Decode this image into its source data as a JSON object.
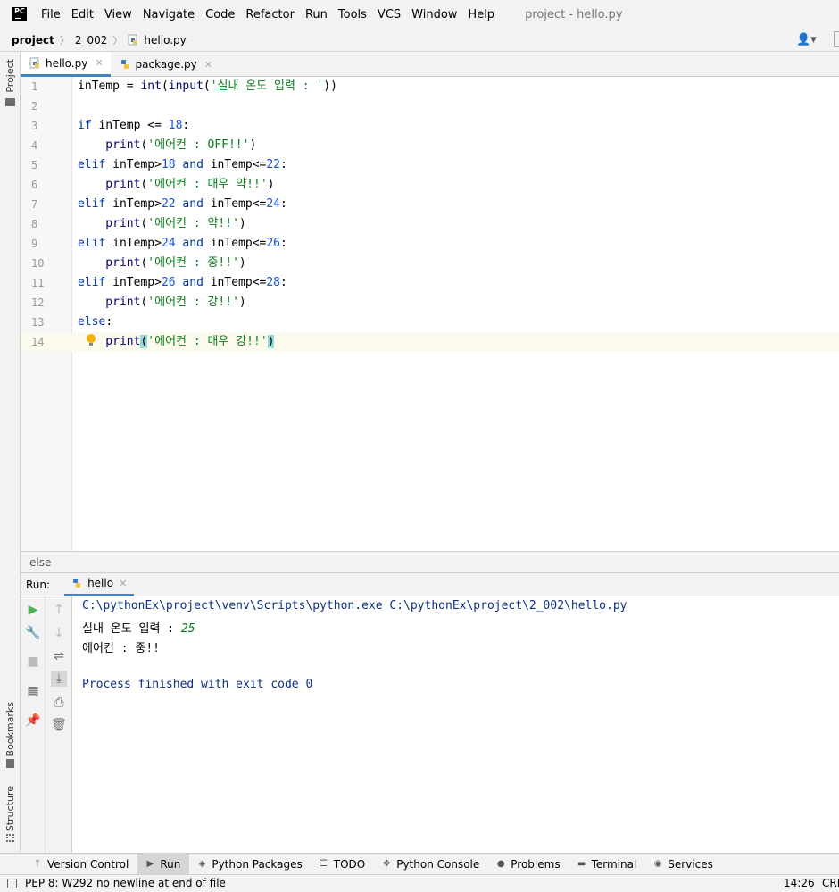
{
  "menu": {
    "logo_text": "PC",
    "items": [
      "File",
      "Edit",
      "View",
      "Navigate",
      "Code",
      "Refactor",
      "Run",
      "Tools",
      "VCS",
      "Window",
      "Help"
    ],
    "window_title": "project - hello.py"
  },
  "nav": {
    "crumbs": [
      "project",
      "2_002",
      "hello.py"
    ]
  },
  "left_strip": {
    "project": "Project",
    "bookmarks": "Bookmarks",
    "structure": "Structure"
  },
  "tabs": [
    {
      "label": "hello.py"
    },
    {
      "label": "package.py"
    }
  ],
  "editor": {
    "line_numbers": [
      "1",
      "2",
      "3",
      "4",
      "5",
      "6",
      "7",
      "8",
      "9",
      "10",
      "11",
      "12",
      "13",
      "14"
    ],
    "lines": [
      [
        {
          "t": "inTemp = ",
          "c": "pr"
        },
        {
          "t": "int",
          "c": "bi"
        },
        {
          "t": "(",
          "c": "pr"
        },
        {
          "t": "input",
          "c": "bi"
        },
        {
          "t": "(",
          "c": "pr"
        },
        {
          "t": "'실내 온도 입력 : '",
          "c": "str"
        },
        {
          "t": "))",
          "c": "pr"
        }
      ],
      [],
      [
        {
          "t": "if ",
          "c": "kw"
        },
        {
          "t": "inTemp <= ",
          "c": "pr"
        },
        {
          "t": "18",
          "c": "num"
        },
        {
          "t": ":",
          "c": "pr"
        }
      ],
      [
        {
          "t": "    print",
          "c": "bi"
        },
        {
          "t": "(",
          "c": "pr"
        },
        {
          "t": "'에어컨 : OFF!!'",
          "c": "str"
        },
        {
          "t": ")",
          "c": "pr"
        }
      ],
      [
        {
          "t": "elif ",
          "c": "kw"
        },
        {
          "t": "inTemp>",
          "c": "pr"
        },
        {
          "t": "18 ",
          "c": "num"
        },
        {
          "t": "and ",
          "c": "kw"
        },
        {
          "t": "inTemp<=",
          "c": "pr"
        },
        {
          "t": "22",
          "c": "num"
        },
        {
          "t": ":",
          "c": "pr"
        }
      ],
      [
        {
          "t": "    print",
          "c": "bi"
        },
        {
          "t": "(",
          "c": "pr"
        },
        {
          "t": "'에어컨 : 매우 약!!'",
          "c": "str"
        },
        {
          "t": ")",
          "c": "pr"
        }
      ],
      [
        {
          "t": "elif ",
          "c": "kw"
        },
        {
          "t": "inTemp>",
          "c": "pr"
        },
        {
          "t": "22 ",
          "c": "num"
        },
        {
          "t": "and ",
          "c": "kw"
        },
        {
          "t": "inTemp<=",
          "c": "pr"
        },
        {
          "t": "24",
          "c": "num"
        },
        {
          "t": ":",
          "c": "pr"
        }
      ],
      [
        {
          "t": "    print",
          "c": "bi"
        },
        {
          "t": "(",
          "c": "pr"
        },
        {
          "t": "'에어컨 : 약!!'",
          "c": "str"
        },
        {
          "t": ")",
          "c": "pr"
        }
      ],
      [
        {
          "t": "elif ",
          "c": "kw"
        },
        {
          "t": "inTemp>",
          "c": "pr"
        },
        {
          "t": "24 ",
          "c": "num"
        },
        {
          "t": "and ",
          "c": "kw"
        },
        {
          "t": "inTemp<=",
          "c": "pr"
        },
        {
          "t": "26",
          "c": "num"
        },
        {
          "t": ":",
          "c": "pr"
        }
      ],
      [
        {
          "t": "    print",
          "c": "bi"
        },
        {
          "t": "(",
          "c": "pr"
        },
        {
          "t": "'에어컨 : 중!!'",
          "c": "str"
        },
        {
          "t": ")",
          "c": "pr"
        }
      ],
      [
        {
          "t": "elif ",
          "c": "kw"
        },
        {
          "t": "inTemp>",
          "c": "pr"
        },
        {
          "t": "26 ",
          "c": "num"
        },
        {
          "t": "and ",
          "c": "kw"
        },
        {
          "t": "inTemp<=",
          "c": "pr"
        },
        {
          "t": "28",
          "c": "num"
        },
        {
          "t": ":",
          "c": "pr"
        }
      ],
      [
        {
          "t": "    print",
          "c": "bi"
        },
        {
          "t": "(",
          "c": "pr"
        },
        {
          "t": "'에어컨 : 강!!'",
          "c": "str"
        },
        {
          "t": ")",
          "c": "pr"
        }
      ],
      [
        {
          "t": "else",
          "c": "kw"
        },
        {
          "t": ":",
          "c": "pr"
        }
      ],
      [
        {
          "t": "    print",
          "c": "bi"
        },
        {
          "t": "(",
          "c": "pr paren-hl"
        },
        {
          "t": "'에어컨 : 매우 강!!'",
          "c": "str"
        },
        {
          "t": ")",
          "c": "pr paren-hl"
        }
      ]
    ]
  },
  "breadcrumb_bar": "else",
  "run": {
    "label": "Run:",
    "tab": "hello",
    "console": {
      "command": "C:\\pythonEx\\project\\venv\\Scripts\\python.exe C:\\pythonEx\\project\\2_002\\hello.py",
      "prompt": "실내 온도 입력 : ",
      "input": "25",
      "output": "에어컨 : 중!!",
      "finished": "Process finished with exit code 0"
    }
  },
  "bottom_tabs": [
    {
      "label": "Version Control",
      "icon": "branch-icon"
    },
    {
      "label": "Run",
      "icon": "run-icon"
    },
    {
      "label": "Python Packages",
      "icon": "layers-icon"
    },
    {
      "label": "TODO",
      "icon": "list-icon"
    },
    {
      "label": "Python Console",
      "icon": "python-icon"
    },
    {
      "label": "Problems",
      "icon": "problems-icon"
    },
    {
      "label": "Terminal",
      "icon": "terminal-icon"
    },
    {
      "label": "Services",
      "icon": "services-icon"
    }
  ],
  "status": {
    "message": "PEP 8: W292 no newline at end of file",
    "position": "14:26",
    "line_sep": "CRL"
  },
  "colors": {
    "keyword": "#0033b3",
    "string": "#067d17",
    "number": "#1750eb",
    "builtin": "#000080",
    "accent": "#4083c9"
  }
}
